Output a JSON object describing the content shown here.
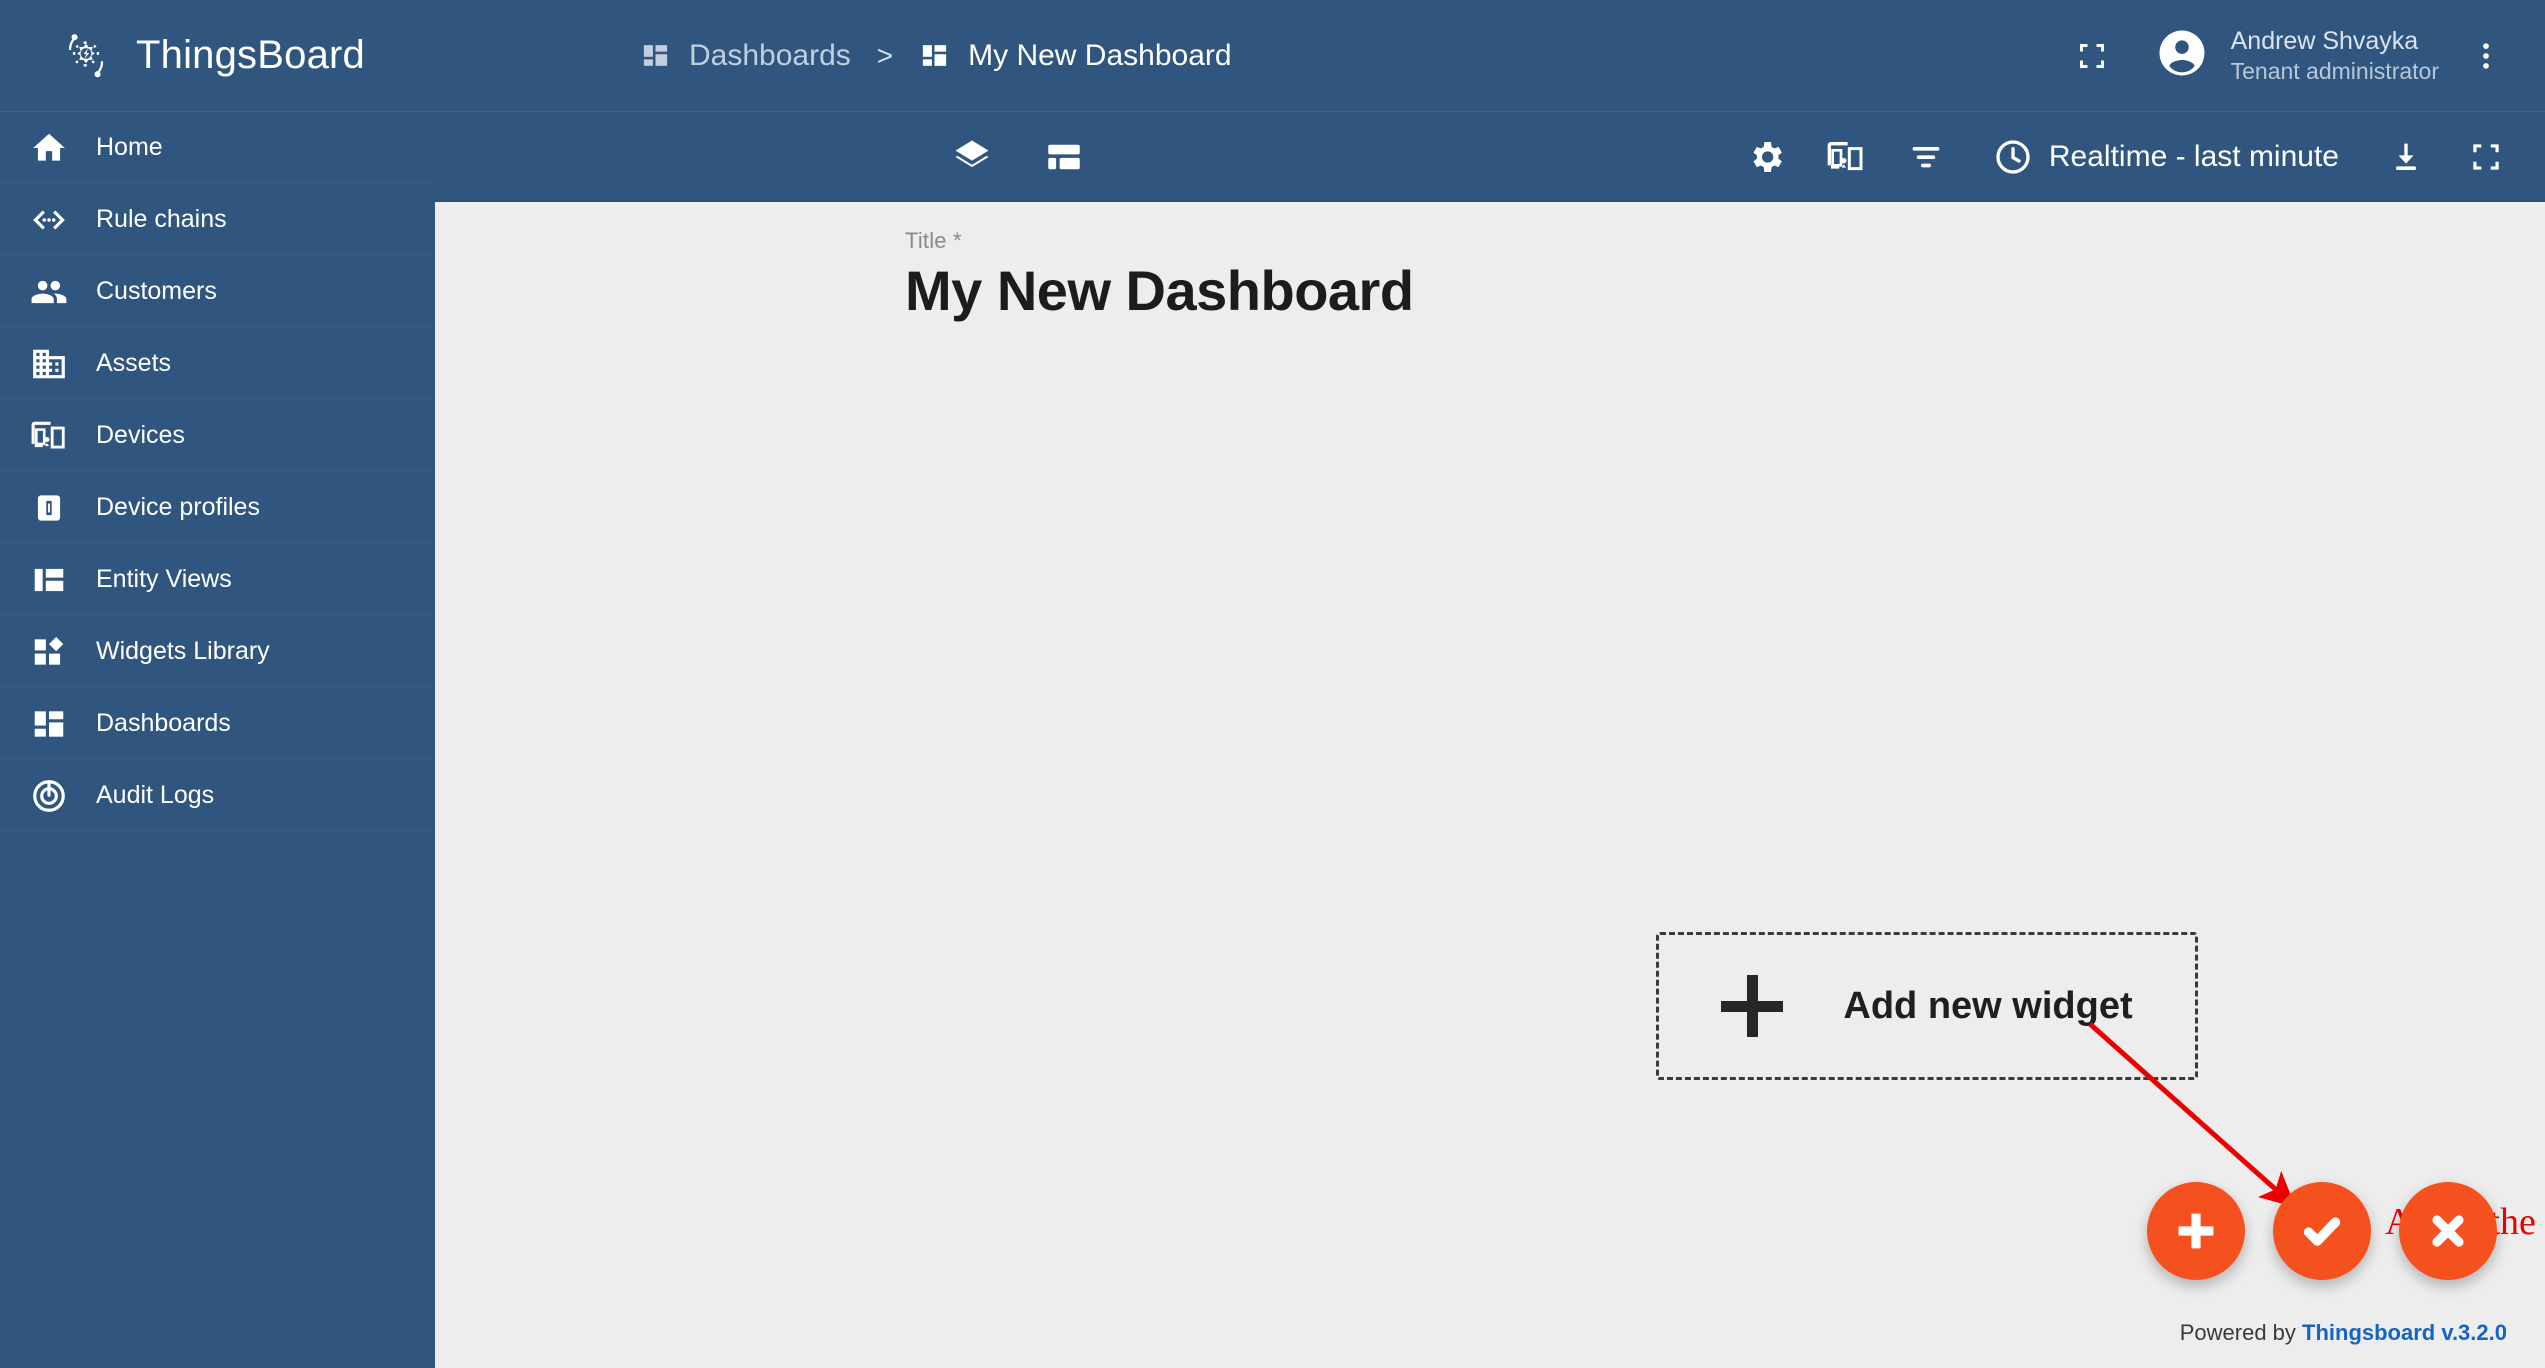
{
  "brand": {
    "name": "ThingsBoard",
    "logo_icon": "thingsboard-logo-icon"
  },
  "sidebar": {
    "items": [
      {
        "label": "Home",
        "icon": "home-icon"
      },
      {
        "label": "Rule chains",
        "icon": "rule-chains-icon"
      },
      {
        "label": "Customers",
        "icon": "customers-icon"
      },
      {
        "label": "Assets",
        "icon": "assets-icon"
      },
      {
        "label": "Devices",
        "icon": "devices-icon"
      },
      {
        "label": "Device profiles",
        "icon": "device-profiles-icon"
      },
      {
        "label": "Entity Views",
        "icon": "entity-views-icon"
      },
      {
        "label": "Widgets Library",
        "icon": "widgets-library-icon"
      },
      {
        "label": "Dashboards",
        "icon": "dashboards-icon"
      },
      {
        "label": "Audit Logs",
        "icon": "audit-logs-icon"
      }
    ]
  },
  "header": {
    "breadcrumb": {
      "parent": "Dashboards",
      "separator": ">",
      "current": "My New Dashboard"
    },
    "fullscreen_icon": "fullscreen-icon",
    "user": {
      "name": "Andrew Shvayka",
      "role": "Tenant administrator",
      "avatar_icon": "account-circle-icon"
    },
    "more_menu_icon": "more-vertical-icon"
  },
  "dashboard_toolbar": {
    "layers_icon": "layers-icon",
    "states_icon": "dashboard-layout-icon",
    "settings_icon": "settings-gear-icon",
    "device_icon": "device-states-icon",
    "filters_icon": "filters-icon",
    "timewindow": {
      "label": "Realtime - last minute",
      "icon": "clock-icon"
    },
    "export_icon": "download-icon",
    "fullscreen_icon": "fullscreen-icon"
  },
  "main": {
    "title_label": "Title *",
    "title_value": "My New Dashboard",
    "add_widget": {
      "label": "Add new widget",
      "icon": "plus-icon"
    }
  },
  "annotation": {
    "text": "Apply the changes",
    "color": "#ee0000"
  },
  "fabs": [
    {
      "name": "add",
      "icon": "plus-icon",
      "color": "#f4511e"
    },
    {
      "name": "apply",
      "icon": "check-icon",
      "color": "#f4511e"
    },
    {
      "name": "cancel",
      "icon": "close-icon",
      "color": "#f4511e"
    }
  ],
  "footer": {
    "prefix": "Powered by ",
    "link": "Thingsboard v.3.2.0"
  },
  "colors": {
    "primary": "#305680",
    "accent": "#f4511e",
    "canvas": "#ededed",
    "link": "#1565c0"
  }
}
